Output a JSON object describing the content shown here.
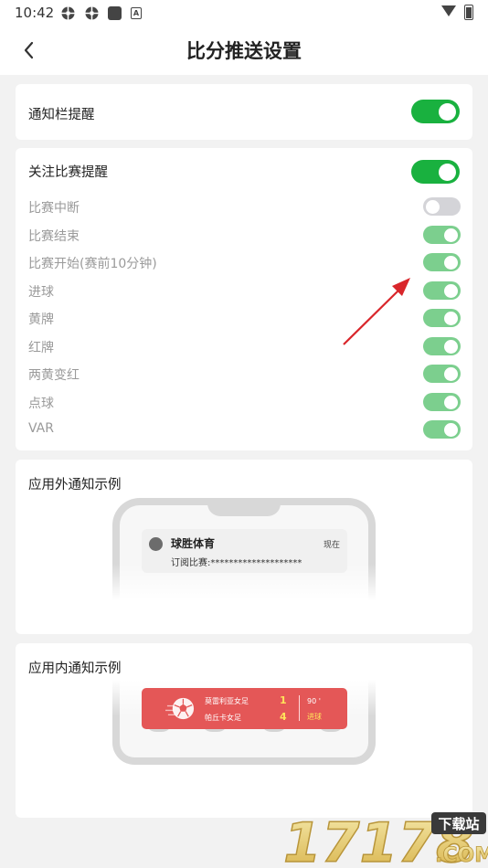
{
  "status_bar": {
    "time": "10:42",
    "badge": "A"
  },
  "header": {
    "title": "比分推送设置"
  },
  "notify_bar": {
    "label": "通知栏提醒",
    "enabled": true
  },
  "follow": {
    "label": "关注比赛提醒",
    "enabled": true,
    "items": [
      {
        "label": "比赛中断",
        "enabled": false
      },
      {
        "label": "比赛结束",
        "enabled": true
      },
      {
        "label": "比赛开始(赛前10分钟)",
        "enabled": true
      },
      {
        "label": "进球",
        "enabled": true
      },
      {
        "label": "黄牌",
        "enabled": true
      },
      {
        "label": "红牌",
        "enabled": true
      },
      {
        "label": "两黄变红",
        "enabled": true
      },
      {
        "label": "点球",
        "enabled": true
      },
      {
        "label": "VAR",
        "enabled": true
      }
    ]
  },
  "outside_example": {
    "title": "应用外通知示例",
    "app_name": "球胜体育",
    "time": "现在",
    "text": "订阅比赛:********************"
  },
  "inside_example": {
    "title": "应用内通知示例",
    "home_team": "莫雷利亚女足",
    "away_team": "帕丘卡女足",
    "home_score": "1",
    "away_score": "4",
    "minute": "90 '",
    "event": "进球"
  },
  "watermark": {
    "text": "17178",
    "site": "下载站",
    "domain": ".COM"
  },
  "colors": {
    "toggle_on": "#19b13f",
    "toggle_on_dim": "#7ccf8e",
    "toggle_off": "#d4d4d8",
    "match_card": "#e45757",
    "annotation_arrow": "#d9262b"
  }
}
